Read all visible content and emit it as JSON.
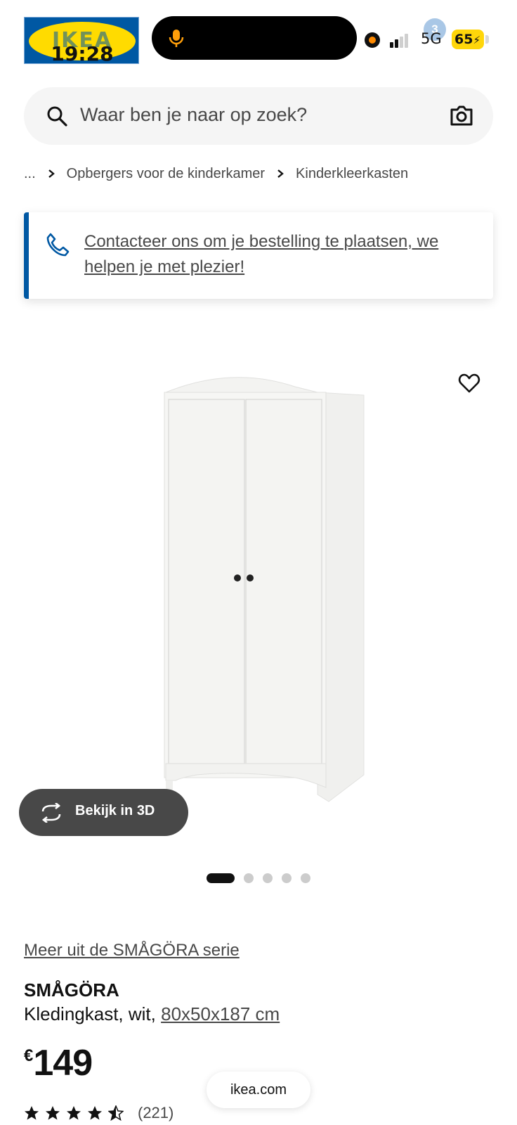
{
  "status_bar": {
    "time": "19:28",
    "logo_text": "IKEA",
    "cart_count": "3",
    "network": "5G",
    "battery": "65"
  },
  "search": {
    "placeholder": "Waar ben je naar op zoek?"
  },
  "breadcrumb": {
    "items": [
      "...",
      "Opbergers voor de kinderkamer",
      "Kinderkleerkasten"
    ]
  },
  "contact_banner": {
    "text": "Contacteer ons om je bestelling te plaatsen, we helpen je met plezier!"
  },
  "gallery": {
    "view_3d_label": "Bekijk in 3D",
    "total_images": 5,
    "active_index": 0
  },
  "product": {
    "series_link": "Meer uit de SMÅGÖRA serie",
    "name": "SMÅGÖRA",
    "description": "Kledingkast, wit,",
    "size": "80x50x187 cm",
    "currency": "€",
    "price": "149",
    "rating_value": 4.5,
    "review_count": "(221)"
  },
  "browser": {
    "url": "ikea.com"
  },
  "icons": {
    "search": "search-icon",
    "camera": "camera-icon",
    "phone": "phone-icon",
    "wishlist": "heart-icon",
    "view_3d": "rotate-3d-icon",
    "star": "star-icon"
  },
  "colors": {
    "ikea_blue": "#0058a3",
    "ikea_yellow": "#ffdb00",
    "text_dark": "#111111",
    "text_grey": "#484848"
  }
}
